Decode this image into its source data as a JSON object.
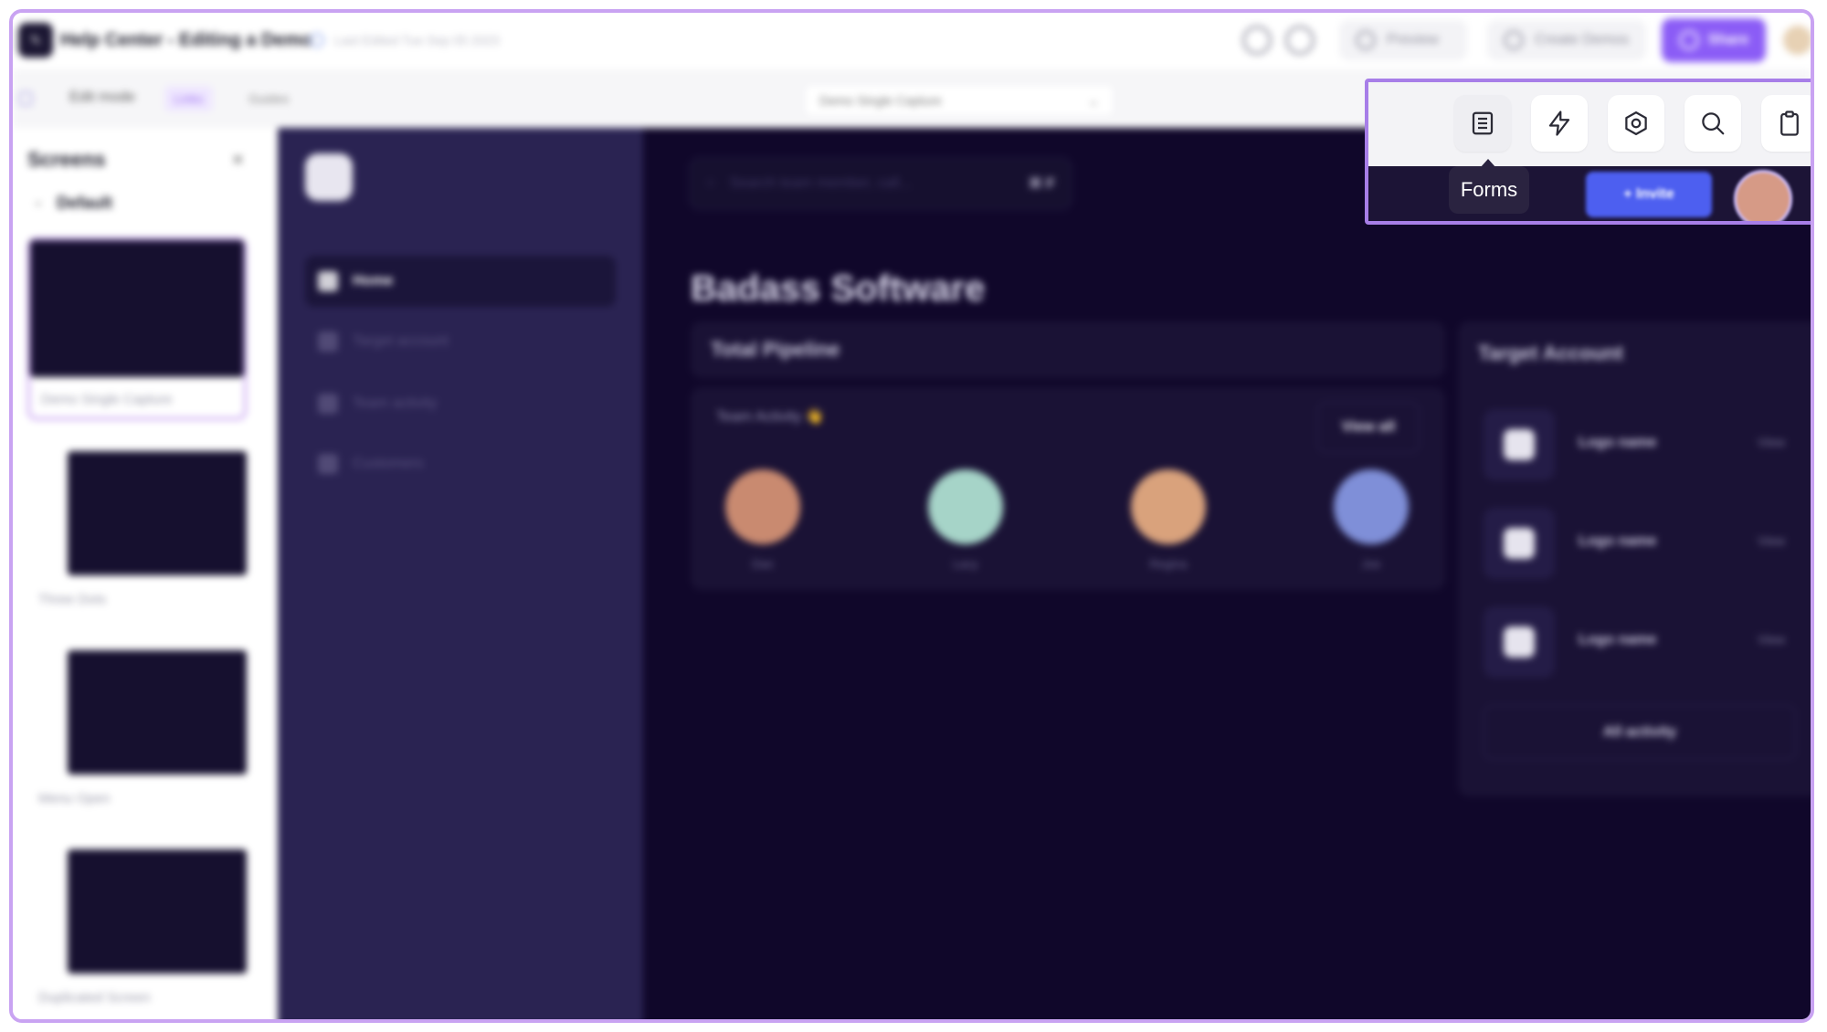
{
  "topbar": {
    "doc_title": "Help Center - Editing a Demo",
    "last_edited": "Last Edited Tue Sep 05 2023",
    "preview_label": "Preview",
    "create_demos_label": "Create Demos",
    "share_label": "Share"
  },
  "toolbar": {
    "edit_mode_label": "Edit mode",
    "links_label": "Links",
    "guides_label": "Guides",
    "screen_select_value": "Demo Single Capture"
  },
  "screens_panel": {
    "title": "Screens",
    "close_glyph": "×",
    "group_name": "Default",
    "thumbnails": [
      {
        "label": "Demo Single Capture"
      },
      {
        "label": "Three Dots"
      },
      {
        "label": "Menu Open"
      },
      {
        "label": "Duplicated Screen"
      }
    ]
  },
  "app": {
    "nav": [
      {
        "label": "Home"
      },
      {
        "label": "Target account"
      },
      {
        "label": "Team activity"
      },
      {
        "label": "Customers"
      }
    ],
    "search_placeholder": "Search team member, call...",
    "search_shortcut": "⌘ F",
    "company_title": "Badass Software",
    "pipeline_title": "Total Pipeline",
    "activity_title": "Team Activity 👋",
    "view_all_label": "View all",
    "members": [
      {
        "name": "Dan",
        "color": "#c98a70"
      },
      {
        "name": "Lacy",
        "color": "#a6d4c8"
      },
      {
        "name": "Regina",
        "color": "#d9a27c"
      },
      {
        "name": "Joe",
        "color": "#7f8fd8"
      }
    ],
    "target_account_title": "Target Account",
    "accounts": [
      {
        "name": "Logo name",
        "view": "View"
      },
      {
        "name": "Logo name",
        "view": "View"
      },
      {
        "name": "Logo name",
        "view": "View"
      }
    ],
    "all_activity_label": "All activity",
    "invite_label": "+ Invite"
  },
  "zoom_toolbar": {
    "tools": [
      {
        "name": "forms",
        "icon": "list-icon"
      },
      {
        "name": "actions",
        "icon": "lightning-icon"
      },
      {
        "name": "settings",
        "icon": "hexagon-gear-icon"
      },
      {
        "name": "search",
        "icon": "search-icon"
      },
      {
        "name": "clipboard",
        "icon": "clipboard-icon"
      }
    ],
    "tooltip": "Forms"
  },
  "colors": {
    "accent": "#8b5cf6",
    "highlight_border": "#a77ee8",
    "app_background": "#10072a",
    "nav_background": "#2a2352",
    "invite_button": "#4d5ff0"
  }
}
